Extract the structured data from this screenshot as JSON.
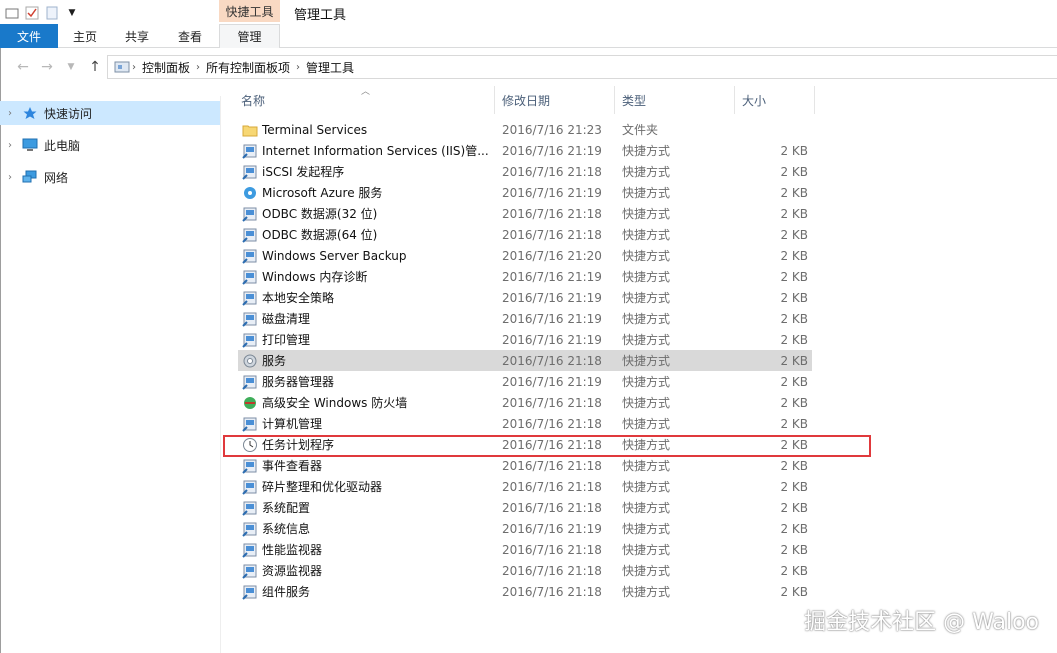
{
  "titlebar": {
    "contextual_tab": "快捷工具",
    "title": "管理工具"
  },
  "ribbon": {
    "tabs": [
      "文件",
      "主页",
      "共享",
      "查看",
      "管理"
    ]
  },
  "address": {
    "crumbs": [
      "控制面板",
      "所有控制面板项",
      "管理工具"
    ]
  },
  "nav": {
    "items": [
      "快速访问",
      "此电脑",
      "网络"
    ]
  },
  "columns": {
    "name": "名称",
    "date": "修改日期",
    "type": "类型",
    "size": "大小"
  },
  "files": [
    {
      "name": "Terminal Services",
      "date": "2016/7/16 21:23",
      "type": "文件夹",
      "size": "",
      "icon": "folder-icon"
    },
    {
      "name": "Internet Information Services (IIS)管...",
      "date": "2016/7/16 21:19",
      "type": "快捷方式",
      "size": "2 KB",
      "icon": "iis-icon"
    },
    {
      "name": "iSCSI 发起程序",
      "date": "2016/7/16 21:18",
      "type": "快捷方式",
      "size": "2 KB",
      "icon": "iscsi-icon"
    },
    {
      "name": "Microsoft Azure 服务",
      "date": "2016/7/16 21:19",
      "type": "快捷方式",
      "size": "2 KB",
      "icon": "azure-icon"
    },
    {
      "name": "ODBC 数据源(32 位)",
      "date": "2016/7/16 21:18",
      "type": "快捷方式",
      "size": "2 KB",
      "icon": "odbc-icon"
    },
    {
      "name": "ODBC 数据源(64 位)",
      "date": "2016/7/16 21:18",
      "type": "快捷方式",
      "size": "2 KB",
      "icon": "odbc-icon"
    },
    {
      "name": "Windows Server Backup",
      "date": "2016/7/16 21:20",
      "type": "快捷方式",
      "size": "2 KB",
      "icon": "backup-icon"
    },
    {
      "name": "Windows 内存诊断",
      "date": "2016/7/16 21:19",
      "type": "快捷方式",
      "size": "2 KB",
      "icon": "memory-icon"
    },
    {
      "name": "本地安全策略",
      "date": "2016/7/16 21:19",
      "type": "快捷方式",
      "size": "2 KB",
      "icon": "security-policy-icon"
    },
    {
      "name": "磁盘清理",
      "date": "2016/7/16 21:19",
      "type": "快捷方式",
      "size": "2 KB",
      "icon": "disk-cleanup-icon"
    },
    {
      "name": "打印管理",
      "date": "2016/7/16 21:19",
      "type": "快捷方式",
      "size": "2 KB",
      "icon": "printer-icon"
    },
    {
      "name": "服务",
      "date": "2016/7/16 21:18",
      "type": "快捷方式",
      "size": "2 KB",
      "icon": "services-icon",
      "highlight": true
    },
    {
      "name": "服务器管理器",
      "date": "2016/7/16 21:19",
      "type": "快捷方式",
      "size": "2 KB",
      "icon": "server-manager-icon"
    },
    {
      "name": "高级安全 Windows 防火墙",
      "date": "2016/7/16 21:18",
      "type": "快捷方式",
      "size": "2 KB",
      "icon": "firewall-icon"
    },
    {
      "name": "计算机管理",
      "date": "2016/7/16 21:18",
      "type": "快捷方式",
      "size": "2 KB",
      "icon": "computer-management-icon"
    },
    {
      "name": "任务计划程序",
      "date": "2016/7/16 21:18",
      "type": "快捷方式",
      "size": "2 KB",
      "icon": "task-scheduler-icon"
    },
    {
      "name": "事件查看器",
      "date": "2016/7/16 21:18",
      "type": "快捷方式",
      "size": "2 KB",
      "icon": "event-viewer-icon"
    },
    {
      "name": "碎片整理和优化驱动器",
      "date": "2016/7/16 21:18",
      "type": "快捷方式",
      "size": "2 KB",
      "icon": "defrag-icon"
    },
    {
      "name": "系统配置",
      "date": "2016/7/16 21:18",
      "type": "快捷方式",
      "size": "2 KB",
      "icon": "system-config-icon"
    },
    {
      "name": "系统信息",
      "date": "2016/7/16 21:19",
      "type": "快捷方式",
      "size": "2 KB",
      "icon": "system-info-icon"
    },
    {
      "name": "性能监视器",
      "date": "2016/7/16 21:18",
      "type": "快捷方式",
      "size": "2 KB",
      "icon": "performance-monitor-icon"
    },
    {
      "name": "资源监视器",
      "date": "2016/7/16 21:18",
      "type": "快捷方式",
      "size": "2 KB",
      "icon": "resource-monitor-icon"
    },
    {
      "name": "组件服务",
      "date": "2016/7/16 21:18",
      "type": "快捷方式",
      "size": "2 KB",
      "icon": "component-services-icon"
    }
  ],
  "watermark": "掘金技术社区 @ Waloo",
  "colors": {
    "file_tab": "#1979ca",
    "context_tab": "#f9d9c3",
    "selected_nav": "#cce8ff",
    "highlight_row": "#d9d9d9",
    "annotation_box": "#e0393c"
  }
}
